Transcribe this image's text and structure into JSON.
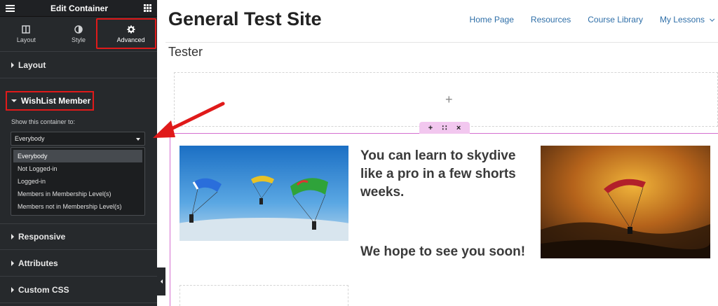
{
  "panel": {
    "title": "Edit Container",
    "tabs": [
      {
        "label": "Layout",
        "icon": "layout-icon"
      },
      {
        "label": "Style",
        "icon": "style-icon"
      },
      {
        "label": "Advanced",
        "icon": "gear-icon"
      }
    ],
    "sections": {
      "layout": "Layout",
      "wishlist": "WishList Member",
      "responsive": "Responsive",
      "attributes": "Attributes",
      "custom_css": "Custom CSS"
    },
    "show_label": "Show this container to:",
    "select_value": "Everybody",
    "options": [
      "Everybody",
      "Not Logged-in",
      "Logged-in",
      "Members in Membership Level(s)",
      "Members not in Membership Level(s)"
    ]
  },
  "site": {
    "title": "General Test Site",
    "nav": [
      "Home Page",
      "Resources",
      "Course Library",
      "My Lessons"
    ],
    "subtitle": "Tester",
    "plus": "+",
    "handle": {
      "add": "+",
      "move": "∷",
      "close": "×"
    },
    "heading": "You can learn to skydive like a pro in a few shorts weeks.",
    "closing": "We hope to see you soon!"
  },
  "colors": {
    "accent_red": "#e01a1a",
    "container_pink": "#d56fd0",
    "link_blue": "#2f6fa8"
  }
}
